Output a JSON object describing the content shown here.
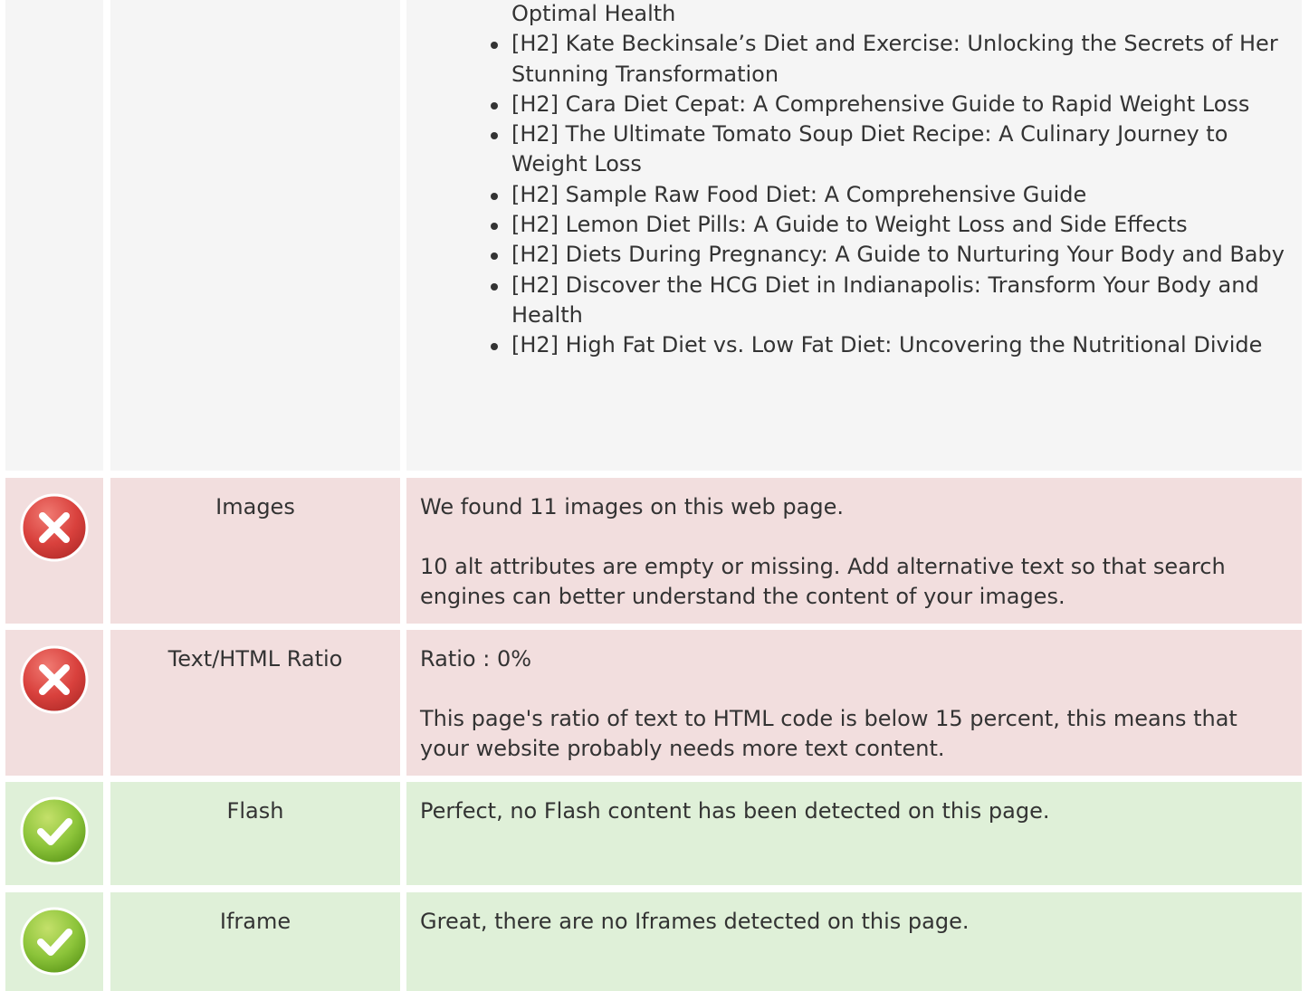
{
  "headings_list": [
    {
      "text": "Optimal Health",
      "continuation": true
    },
    {
      "text": "[H2] Kate Beckinsale’s Diet and Exercise: Unlocking the Secrets of Her Stunning Transformation"
    },
    {
      "text": "[H2] Cara Diet Cepat: A Comprehensive Guide to Rapid Weight Loss"
    },
    {
      "text": "[H2] The Ultimate Tomato Soup Diet Recipe: A Culinary Journey to Weight Loss"
    },
    {
      "text": "[H2] Sample Raw Food Diet: A Comprehensive Guide"
    },
    {
      "text": "[H2] Lemon Diet Pills: A Guide to Weight Loss and Side Effects"
    },
    {
      "text": "[H2] Diets During Pregnancy: A Guide to Nurturing Your Body and Baby"
    },
    {
      "text": "[H2] Discover the HCG Diet in Indianapolis: Transform Your Body and Health"
    },
    {
      "text": "[H2] High Fat Diet vs. Low Fat Diet: Uncovering the Nutritional Divide"
    }
  ],
  "checks": {
    "images": {
      "status": "error",
      "status_icon": "error-x-icon",
      "label": "Images",
      "line1": "We found 11 images on this web page.",
      "line2": "10 alt attributes are empty or missing. Add alternative text so that search engines can better understand the content of your images."
    },
    "text_html_ratio": {
      "status": "error",
      "status_icon": "error-x-icon",
      "label": "Text/HTML Ratio",
      "line1": "Ratio : 0%",
      "line2": "This page's ratio of text to HTML code is below 15 percent, this means that your website probably needs more text content."
    },
    "flash": {
      "status": "ok",
      "status_icon": "check-icon",
      "label": "Flash",
      "line1": "Perfect, no Flash content has been detected on this page."
    },
    "iframe": {
      "status": "ok",
      "status_icon": "check-icon",
      "label": "Iframe",
      "line1": "Great, there are no Iframes detected on this page."
    }
  },
  "colors": {
    "error_bg": "#f2dede",
    "ok_bg": "#dff0d8",
    "neutral_bg": "#f5f5f5",
    "error_icon": "#d9413d",
    "ok_icon": "#7fb928",
    "text": "#333333"
  }
}
